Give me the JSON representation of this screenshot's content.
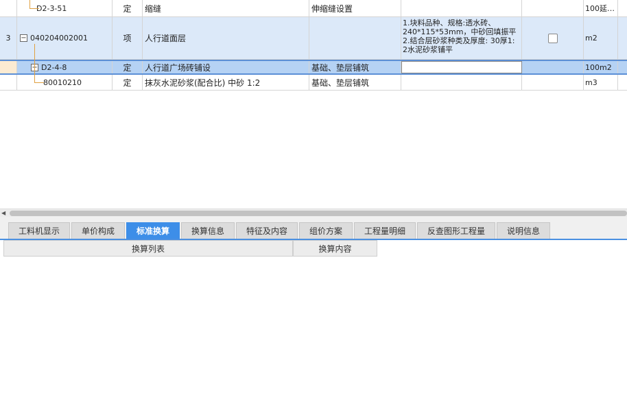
{
  "rows": [
    {
      "index": "",
      "code": "D2-3-51",
      "category": "定",
      "name": "缩缝",
      "work": "伸缩缝设置",
      "feature": "",
      "unit": "100延…"
    },
    {
      "index": "3",
      "code": "040204002001",
      "category": "项",
      "name": "人行道面层",
      "work": "",
      "feature": "1.块料品种、规格:透水砖、240*115*53mm，中砂回填振平\n2.结合层砂浆种类及厚度: 30厚1: 2水泥砂浆铺平",
      "unit": "m2"
    },
    {
      "index": "",
      "code": "D2-4-8",
      "category": "定",
      "name": "人行道广场砖铺设",
      "work": "基础、垫层铺筑",
      "feature": "",
      "unit": "100m2"
    },
    {
      "index": "",
      "code": "80010210",
      "category": "定",
      "name": "抹灰水泥砂浆(配合比) 中砂 1:2",
      "work": "基础、垫层铺筑",
      "feature": "",
      "unit": "m3"
    }
  ],
  "expander_symbols": {
    "collapse": "−",
    "expand": "+"
  },
  "tabs": [
    "工料机显示",
    "单价构成",
    "标准换算",
    "换算信息",
    "特征及内容",
    "组价方案",
    "工程量明细",
    "反查图形工程量",
    "说明信息"
  ],
  "active_tab": "标准换算",
  "panel": {
    "col_list": "换算列表",
    "col_content": "换算内容"
  },
  "colors": {
    "accent": "#3d8ee8",
    "selected_row": "#b5d2f4",
    "item_row": "#dce9f9",
    "tree_line": "#e0a040"
  }
}
